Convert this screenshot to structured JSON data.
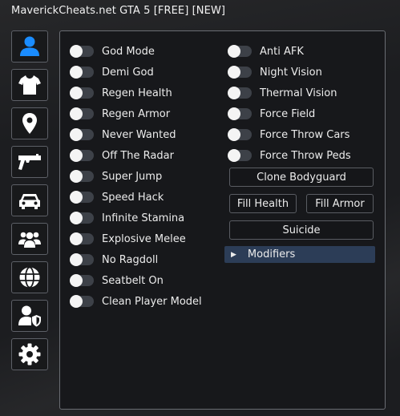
{
  "window": {
    "title": "MaverickCheats.net GTA 5 [FREE] [NEW]"
  },
  "sidebar": {
    "items": [
      {
        "name": "player",
        "icon": "user-icon",
        "color": "#1a8cff"
      },
      {
        "name": "clothing",
        "icon": "tshirt-icon"
      },
      {
        "name": "teleport",
        "icon": "map-pin-icon"
      },
      {
        "name": "weapons",
        "icon": "gun-icon"
      },
      {
        "name": "vehicles",
        "icon": "car-icon"
      },
      {
        "name": "players",
        "icon": "users-icon"
      },
      {
        "name": "network",
        "icon": "globe-icon"
      },
      {
        "name": "protections",
        "icon": "user-shield-icon"
      },
      {
        "name": "settings",
        "icon": "gear-icon"
      }
    ]
  },
  "left_toggles": [
    "God Mode",
    "Demi God",
    "Regen Health",
    "Regen Armor",
    "Never Wanted",
    "Off The Radar",
    "Super Jump",
    "Speed Hack",
    "Infinite Stamina",
    "Explosive Melee",
    "No Ragdoll",
    "Seatbelt On",
    "Clean Player Model"
  ],
  "right_toggles": [
    "Anti AFK",
    "Night Vision",
    "Thermal Vision",
    "Force Field",
    "Force Throw Cars",
    "Force Throw Peds"
  ],
  "buttons": {
    "clone_bodyguard": "Clone Bodyguard",
    "fill_health": "Fill Health",
    "fill_armor": "Fill Armor",
    "suicide": "Suicide"
  },
  "tree": {
    "arrow": "▶",
    "label": "Modifiers"
  },
  "colors": {
    "accent": "#1a8cff",
    "tree_bg": "#2c3d57"
  }
}
